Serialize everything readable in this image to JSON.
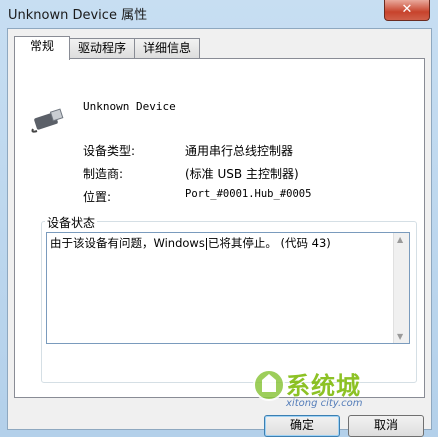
{
  "window": {
    "title": "Unknown Device 属性",
    "close_label": "✕"
  },
  "tabs": [
    {
      "label": "常规",
      "active": true
    },
    {
      "label": "驱动程序",
      "active": false
    },
    {
      "label": "详细信息",
      "active": false
    }
  ],
  "device": {
    "icon": "usb-connector-icon",
    "name": "Unknown Device",
    "rows": [
      {
        "label": "设备类型:",
        "value": "通用串行总线控制器"
      },
      {
        "label": "制造商:",
        "value": "(标准 USB 主控制器)"
      },
      {
        "label": "位置:",
        "value": "Port_#0001.Hub_#0005"
      }
    ]
  },
  "status": {
    "legend": "设备状态",
    "text_before_caret": "由于该设备有问题，Windows",
    "text_after_caret": "已将其停止。 (代码 43)"
  },
  "buttons": {
    "ok": "确定",
    "cancel": "取消"
  },
  "watermark": {
    "title": "系统城",
    "sub": "xitong city.com",
    "accent": "#7ab800"
  }
}
